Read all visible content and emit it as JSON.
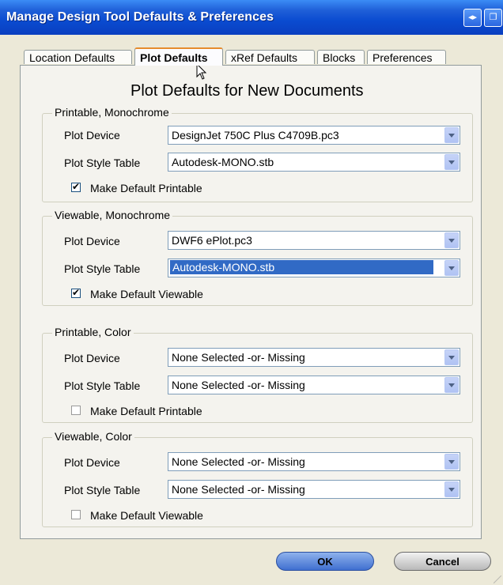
{
  "window": {
    "title": "Manage Design Tool Defaults & Preferences"
  },
  "titlebar_buttons": [
    {
      "icon": "help-icon",
      "glyph": "◂▸"
    },
    {
      "icon": "restore-icon",
      "glyph": "❐"
    }
  ],
  "tabs": [
    {
      "label": "Location Defaults",
      "active": false
    },
    {
      "label": "Plot Defaults",
      "active": true
    },
    {
      "label": "xRef Defaults",
      "active": false
    },
    {
      "label": "Blocks",
      "active": false
    },
    {
      "label": "Preferences",
      "active": false
    }
  ],
  "heading": "Plot Defaults for New Documents",
  "groups": [
    {
      "legend": "Printable, Monochrome",
      "plot_device_label": "Plot Device",
      "plot_device_value": "DesignJet 750C Plus C4709B.pc3",
      "plot_style_label": "Plot Style Table",
      "plot_style_value": "Autodesk-MONO.stb",
      "checkbox_label": "Make Default Printable",
      "checked": true
    },
    {
      "legend": "Viewable, Monochrome",
      "plot_device_label": "Plot Device",
      "plot_device_value": "DWF6 ePlot.pc3",
      "plot_style_label": "Plot Style Table",
      "plot_style_value": "Autodesk-MONO.stb",
      "checkbox_label": "Make Default Viewable",
      "checked": true
    },
    {
      "legend": "Printable, Color",
      "plot_device_label": "Plot Device",
      "plot_device_value": "None Selected -or- Missing",
      "plot_style_label": "Plot Style Table",
      "plot_style_value": "None Selected -or- Missing",
      "checkbox_label": "Make Default Printable",
      "checked": false
    },
    {
      "legend": "Viewable, Color",
      "plot_device_label": "Plot Device",
      "plot_device_value": "None Selected -or- Missing",
      "plot_style_label": "Plot Style Table",
      "plot_style_value": "None Selected -or- Missing",
      "checkbox_label": "Make Default Viewable",
      "checked": false
    }
  ],
  "buttons": {
    "ok": "OK",
    "cancel": "Cancel"
  },
  "colors": {
    "titlebar": "#0a4bd0",
    "selection": "#316ac5",
    "active_tab_accent": "#e68b2c"
  }
}
